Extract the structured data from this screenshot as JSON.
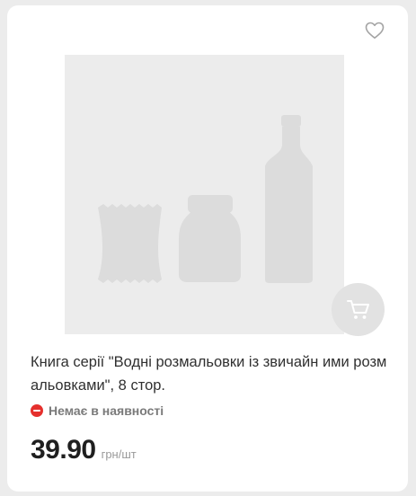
{
  "product": {
    "title": "Книга серії \"Водні розмальовки із звичайн ими розмальовками\", 8 стор.",
    "availability": "Немає в наявності",
    "price": "39.90",
    "price_unit": "грн/шт",
    "image": "placeholder-products-image",
    "favorite_icon": "heart-outline-icon",
    "cart_icon": "shopping-cart-icon"
  },
  "colors": {
    "availability_icon": "#e5302d",
    "placeholder_bg": "#ececec",
    "placeholder_shapes": "#dcdcdc",
    "cart_button_bg": "#e2e2e2"
  }
}
